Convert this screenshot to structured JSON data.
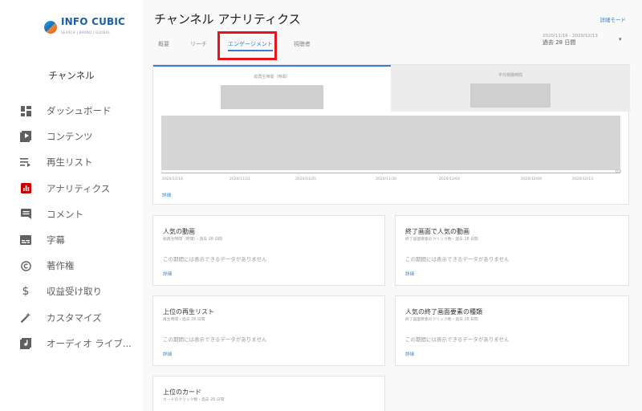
{
  "sidebar": {
    "logo_text": "INFO CUBIC",
    "logo_sub": "SEARCH | BRAND | GLOBAL",
    "channel_label": "チャンネル",
    "items": [
      {
        "label": "ダッシュボード",
        "icon": "dashboard-icon"
      },
      {
        "label": "コンテンツ",
        "icon": "video-content-icon"
      },
      {
        "label": "再生リスト",
        "icon": "playlist-icon"
      },
      {
        "label": "アナリティクス",
        "icon": "analytics-icon",
        "active": true
      },
      {
        "label": "コメント",
        "icon": "comment-icon"
      },
      {
        "label": "字幕",
        "icon": "subtitles-icon"
      },
      {
        "label": "著作権",
        "icon": "copyright-icon"
      },
      {
        "label": "収益受け取り",
        "icon": "dollar-icon"
      },
      {
        "label": "カスタマイズ",
        "icon": "magic-wand-icon"
      },
      {
        "label": "オーディオ ライブ...",
        "icon": "audio-library-icon"
      }
    ]
  },
  "header": {
    "title": "チャンネル アナリティクス",
    "detail_mode": "詳細モード",
    "tabs": [
      {
        "label": "概要"
      },
      {
        "label": "リーチ"
      },
      {
        "label": "エンゲージメント",
        "selected": true
      },
      {
        "label": "視聴者"
      }
    ],
    "date_range": "2020/11/16 - 2020/12/13",
    "date_period": "過去 28 日間"
  },
  "chart_card": {
    "metric1_label": "総再生時間（時間）",
    "metric2_label": "平均視聴時間",
    "x_ticks": [
      "2020/11/16",
      "2020/11/21",
      "2020/11/25",
      "2020/11/30",
      "2020/12/04",
      "2020/12/09",
      "2020/12/13"
    ],
    "top_tick": "0.0",
    "detail_link": "詳細"
  },
  "cards": [
    {
      "title": "人気の動画",
      "sub": "総再生時間（時間）・過去 28 日間",
      "empty": "この期間には表示できるデータがありません",
      "link": "詳細"
    },
    {
      "title": "終了画面で人気の動画",
      "sub": "終了画面要素のクリック数・過去 28 日間",
      "empty": "この期間には表示できるデータがありません",
      "link": "詳細"
    },
    {
      "title": "上位の再生リスト",
      "sub": "再生時間・過去 28 日間",
      "empty": "この期間には表示できるデータがありません",
      "link": "詳細"
    },
    {
      "title": "人気の終了画面要素の種類",
      "sub": "終了画面要素のクリック数・過去 28 日間",
      "empty": "この期間には表示できるデータがありません",
      "link": "詳細"
    },
    {
      "title": "上位のカード",
      "sub": "カードのクリック数・過去 28 日間"
    }
  ],
  "colors": {
    "accent": "#3a7bd5",
    "active_nav": "#cc0000",
    "highlight_box": "#e6141b"
  }
}
